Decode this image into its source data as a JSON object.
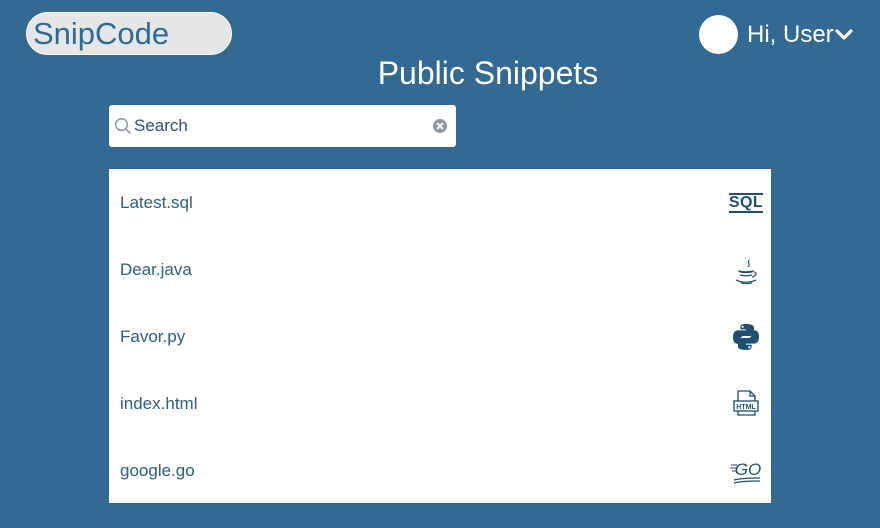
{
  "header": {
    "logo_text": "SnipCode",
    "greeting": "Hi, User",
    "page_title": "Public Snippets"
  },
  "search": {
    "placeholder": "Search"
  },
  "snippets": [
    {
      "name": "Latest.sql",
      "icon": "sql-icon"
    },
    {
      "name": "Dear.java",
      "icon": "java-icon"
    },
    {
      "name": "Favor.py",
      "icon": "python-icon"
    },
    {
      "name": "index.html",
      "icon": "html-icon"
    },
    {
      "name": "google.go",
      "icon": "go-icon"
    }
  ],
  "icon_labels": {
    "sql": "SQL",
    "html": "HTML",
    "go": "GO"
  },
  "colors": {
    "background": "#336a93",
    "logo_bg": "#e4e6e8",
    "text_primary": "#2d5f80",
    "icon_color": "#1f4f71"
  }
}
